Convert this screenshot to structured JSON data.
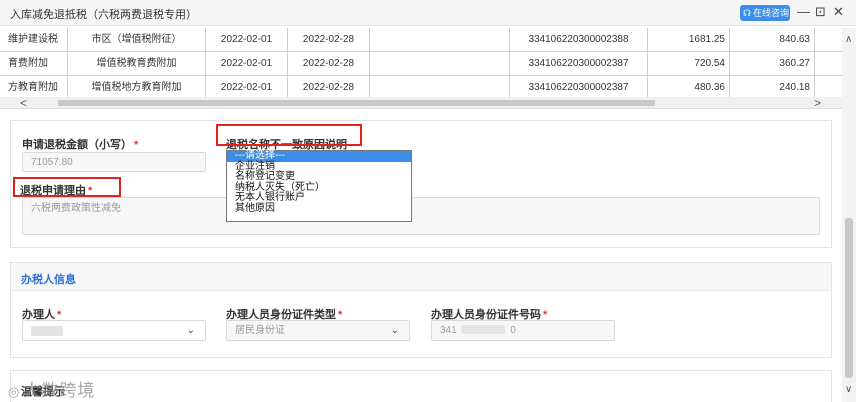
{
  "window": {
    "title": "入库减免退抵税（六税两费退税专用）",
    "consult_label": "在线咨询",
    "consult_icon": "headset-icon",
    "minimize": "—",
    "restore": "⊡",
    "close": "✕"
  },
  "table": {
    "rows": [
      [
        "维护建设税",
        "市区（增值税附征）",
        "2022-02-01",
        "2022-02-28",
        "",
        "334106220300002388",
        "1681.25",
        "840.63"
      ],
      [
        "育费附加",
        "增值税教育费附加",
        "2022-02-01",
        "2022-02-28",
        "",
        "334106220300002387",
        "720.54",
        "360.27"
      ],
      [
        "方教育附加",
        "增值税地方教育附加",
        "2022-02-01",
        "2022-02-28",
        "",
        "334106220300002387",
        "480.36",
        "240.18"
      ]
    ],
    "scroll_left": "<",
    "scroll_right": ">"
  },
  "refund": {
    "amount_label": "申请退税金额（小写）",
    "amount_value": "71057.80",
    "reason_label": "退税申请理由",
    "reason_value": "六税两费政策性减免",
    "mismatch_label": "退税名称不一致原因说明",
    "required_mark": "*",
    "mismatch_options": [
      "---请选择---",
      "企业注销",
      "名称登记变更",
      "纳税人灭失（死亡）",
      "无本人银行账户",
      "其他原因"
    ],
    "selected_option_index": 0
  },
  "agent": {
    "section_title": "办税人信息",
    "agent_label": "办理人",
    "id_type_label": "办理人员身份证件类型",
    "id_type_value": "居民身份证",
    "id_no_label": "办理人员身份证件号码",
    "id_no_prefix": "341",
    "id_no_suffix": "0"
  },
  "bottom": {
    "section_title": "温馨提示"
  },
  "watermark": {
    "text": "大数跨境"
  },
  "colors": {
    "accent": "#2f6fd6",
    "highlight_box": "#e0231b",
    "selected_option": "#3d8ee8",
    "required": "#e23232"
  }
}
